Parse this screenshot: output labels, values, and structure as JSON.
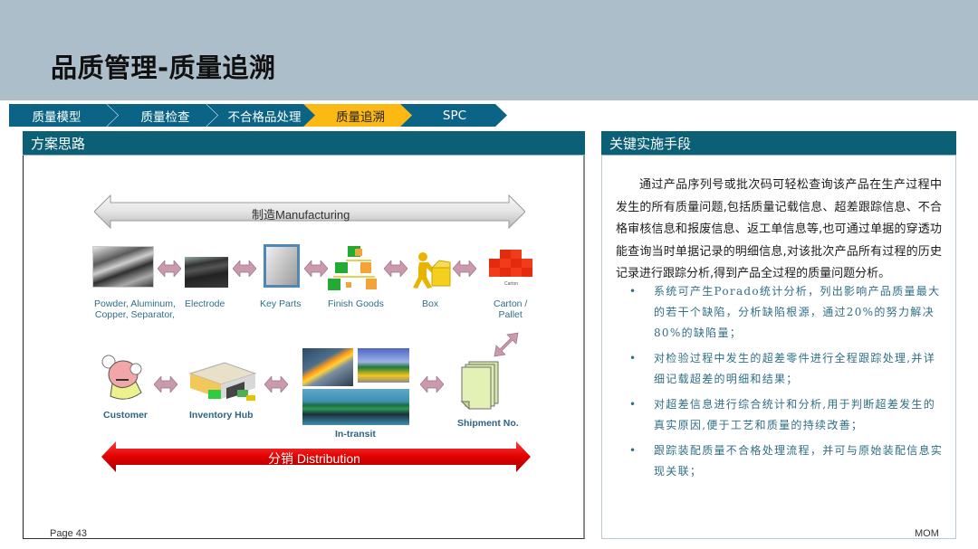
{
  "page": {
    "title": "品质管理-质量追溯",
    "footer_page": "Page 43",
    "footer_brand": "MOM"
  },
  "stepper": {
    "steps": [
      {
        "label": "质量模型",
        "active": false
      },
      {
        "label": "质量检查",
        "active": false
      },
      {
        "label": "不合格品处理",
        "active": false
      },
      {
        "label": "质量追溯",
        "active": true
      },
      {
        "label": "SPC",
        "active": false
      }
    ],
    "colors": {
      "default": "#0b6485",
      "active": "#fdb913"
    }
  },
  "left_panel": {
    "title": "方案思路",
    "diagram": {
      "manufacturing_label": "制造Manufacturing",
      "distribution_label": "分销 Distribution",
      "manufacturing_nodes": [
        {
          "label": "Powder, Aluminum,\nCopper, Separator,",
          "icon": "raw-materials-icon"
        },
        {
          "label": "Electrode",
          "icon": "electrode-icon"
        },
        {
          "label": "Key Parts",
          "icon": "battery-cell-icon"
        },
        {
          "label": "Finish Goods",
          "icon": "finish-goods-icon"
        },
        {
          "label": "Box",
          "icon": "box-packing-icon"
        },
        {
          "label": "Carton /\nPallet",
          "icon": "carton-stack-icon",
          "sublabel": "Carton"
        }
      ],
      "distribution_nodes": [
        {
          "label": "Customer",
          "icon": "angry-customer-icon"
        },
        {
          "label": "Inventory Hub",
          "icon": "warehouse-icon"
        },
        {
          "label": "In-transit",
          "icon": "transport-icon"
        },
        {
          "label": "Shipment No.",
          "icon": "documents-icon"
        }
      ]
    }
  },
  "right_panel": {
    "title": "关键实施手段",
    "intro": "通过产品序列号或批次码可轻松查询该产品在生产过程中发生的所有质量问题,包括质量记载信息、超差跟踪信息、不合格审核信息和报废信息、返工单信息等,也可通过单据的穿透功能查询当时单据记录的明细信息,对该批次产品所有过程的历史记录进行跟踪分析,得到产品全过程的质量问题分析。",
    "bullets": [
      "系统可产生Porado统计分析，列出影响产品质量最大的若干个缺陷，分析缺陷根源，通过20%的努力解决80%的缺陷量；",
      "对检验过程中发生的超差零件进行全程跟踪处理,并详细记载超差的明细和结果；",
      "对超差信息进行综合统计和分析,用于判断超差发生的真实原因,便于工艺和质量的持续改善；",
      "跟踪装配质量不合格处理流程，并可与原始装配信息实现关联；"
    ]
  }
}
